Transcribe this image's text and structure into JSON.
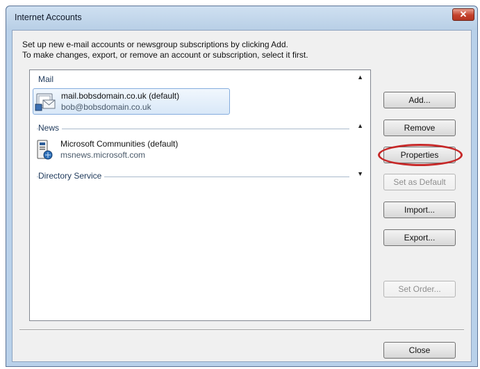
{
  "window": {
    "title": "Internet Accounts",
    "close_glyph": "✕"
  },
  "instructions": {
    "line1": "Set up new e-mail accounts or newsgroup subscriptions by clicking Add.",
    "line2": "To make changes, export, or remove an account or subscription, select it first."
  },
  "accounts": {
    "groups": [
      {
        "name": "Mail",
        "chevron": "▲",
        "items": [
          {
            "name": "mail.bobsdomain.co.uk (default)",
            "subtitle": "bob@bobsdomain.co.uk",
            "icon": "mail-account-icon",
            "selected": true
          }
        ]
      },
      {
        "name": "News",
        "chevron": "▲",
        "items": [
          {
            "name": "Microsoft Communities (default)",
            "subtitle": "msnews.microsoft.com",
            "icon": "news-account-icon",
            "selected": false
          }
        ]
      },
      {
        "name": "Directory Service",
        "chevron": "▼",
        "items": []
      }
    ]
  },
  "buttons": {
    "add": "Add...",
    "remove": "Remove",
    "properties": "Properties",
    "set_default": "Set as Default",
    "import": "Import...",
    "export": "Export...",
    "set_order": "Set Order...",
    "close": "Close"
  },
  "colors": {
    "annotation_ring": "#c62828",
    "selection_border": "#84acdd",
    "title_close": "#c4412b"
  }
}
